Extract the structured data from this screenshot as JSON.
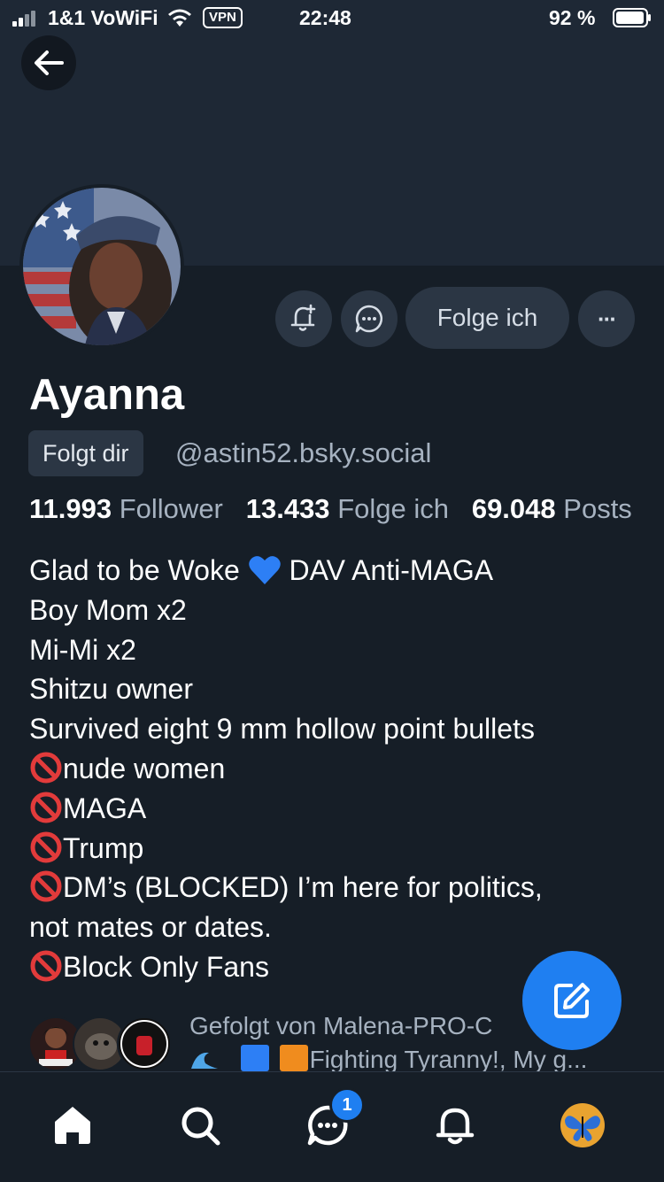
{
  "status_bar": {
    "carrier": "1&1 VoWiFi",
    "vpn": "VPN",
    "time": "22:48",
    "battery": "92 %"
  },
  "profile": {
    "name": "Ayanna",
    "follows_you_badge": "Folgt dir",
    "handle": "@astin52.bsky.social",
    "follow_button_label": "Folge ich",
    "more_label": "···",
    "stats": {
      "followers_count": "11.993",
      "followers_label": "Follower",
      "following_count": "13.433",
      "following_label": "Folge ich",
      "posts_count": "69.048",
      "posts_label": "Posts"
    },
    "bio": {
      "line1_a": "Glad to be Woke",
      "line1_b": "DAV Anti-MAGA",
      "line2": "Boy Mom x2",
      "line3": "Mi-Mi x2",
      "line4": "Shitzu owner",
      "line5": "Survived eight 9 mm hollow point bullets",
      "line6": "nude women",
      "line7": "MAGA",
      "line8": "Trump",
      "line9": "DM’s (BLOCKED) I’m here for politics,",
      "line10": "not mates or dates.",
      "line11": "Block Only Fans"
    },
    "followed_by_line1": "Gefolgt von Malena-PRO-C",
    "followed_by_line2": "Fighting Tyranny!, My g..."
  },
  "nav": {
    "items": [
      "home-icon",
      "search-icon",
      "chat-icon",
      "bell-icon",
      "profile-avatar"
    ],
    "chat_badge": "1"
  },
  "colors": {
    "background": "#161e27",
    "banner": "#1e2835",
    "button": "#2b3644",
    "accent": "#1f7ff1",
    "muted_text": "#a6b2c0"
  }
}
